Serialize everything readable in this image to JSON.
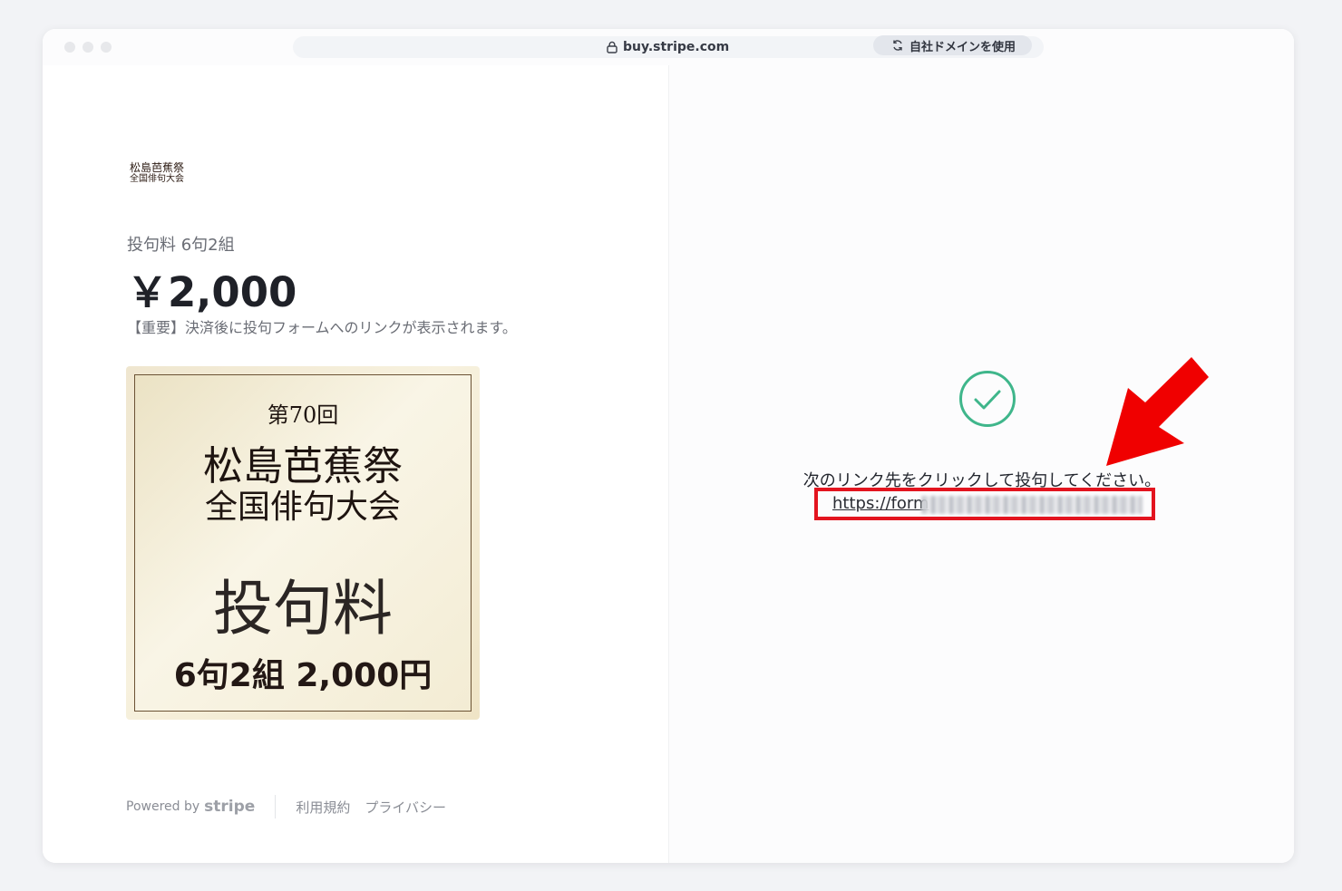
{
  "browser": {
    "url": "buy.stripe.com",
    "custom_domain_label": "自社ドメインを使用"
  },
  "brand": {
    "line1": "松島芭蕉祭",
    "line2": "全国俳句大会"
  },
  "product": {
    "name": "投句料 6句2組",
    "price": "￥2,000",
    "note": "【重要】決済後に投句フォームへのリンクが表示されます。"
  },
  "product_image": {
    "edition": "第70回",
    "title1": "松島芭蕉祭",
    "title2": "全国俳句大会",
    "fee": "投句料",
    "detail": "6句2組 2,000円"
  },
  "footer": {
    "powered_by": "Powered by",
    "stripe": "stripe",
    "terms": "利用規約",
    "privacy": "プライバシー"
  },
  "success": {
    "message": "次のリンク先をクリックして投句してください。",
    "link_prefix": "https://form"
  },
  "colors": {
    "check": "#3fb68b",
    "highlight": "#e3141f"
  }
}
